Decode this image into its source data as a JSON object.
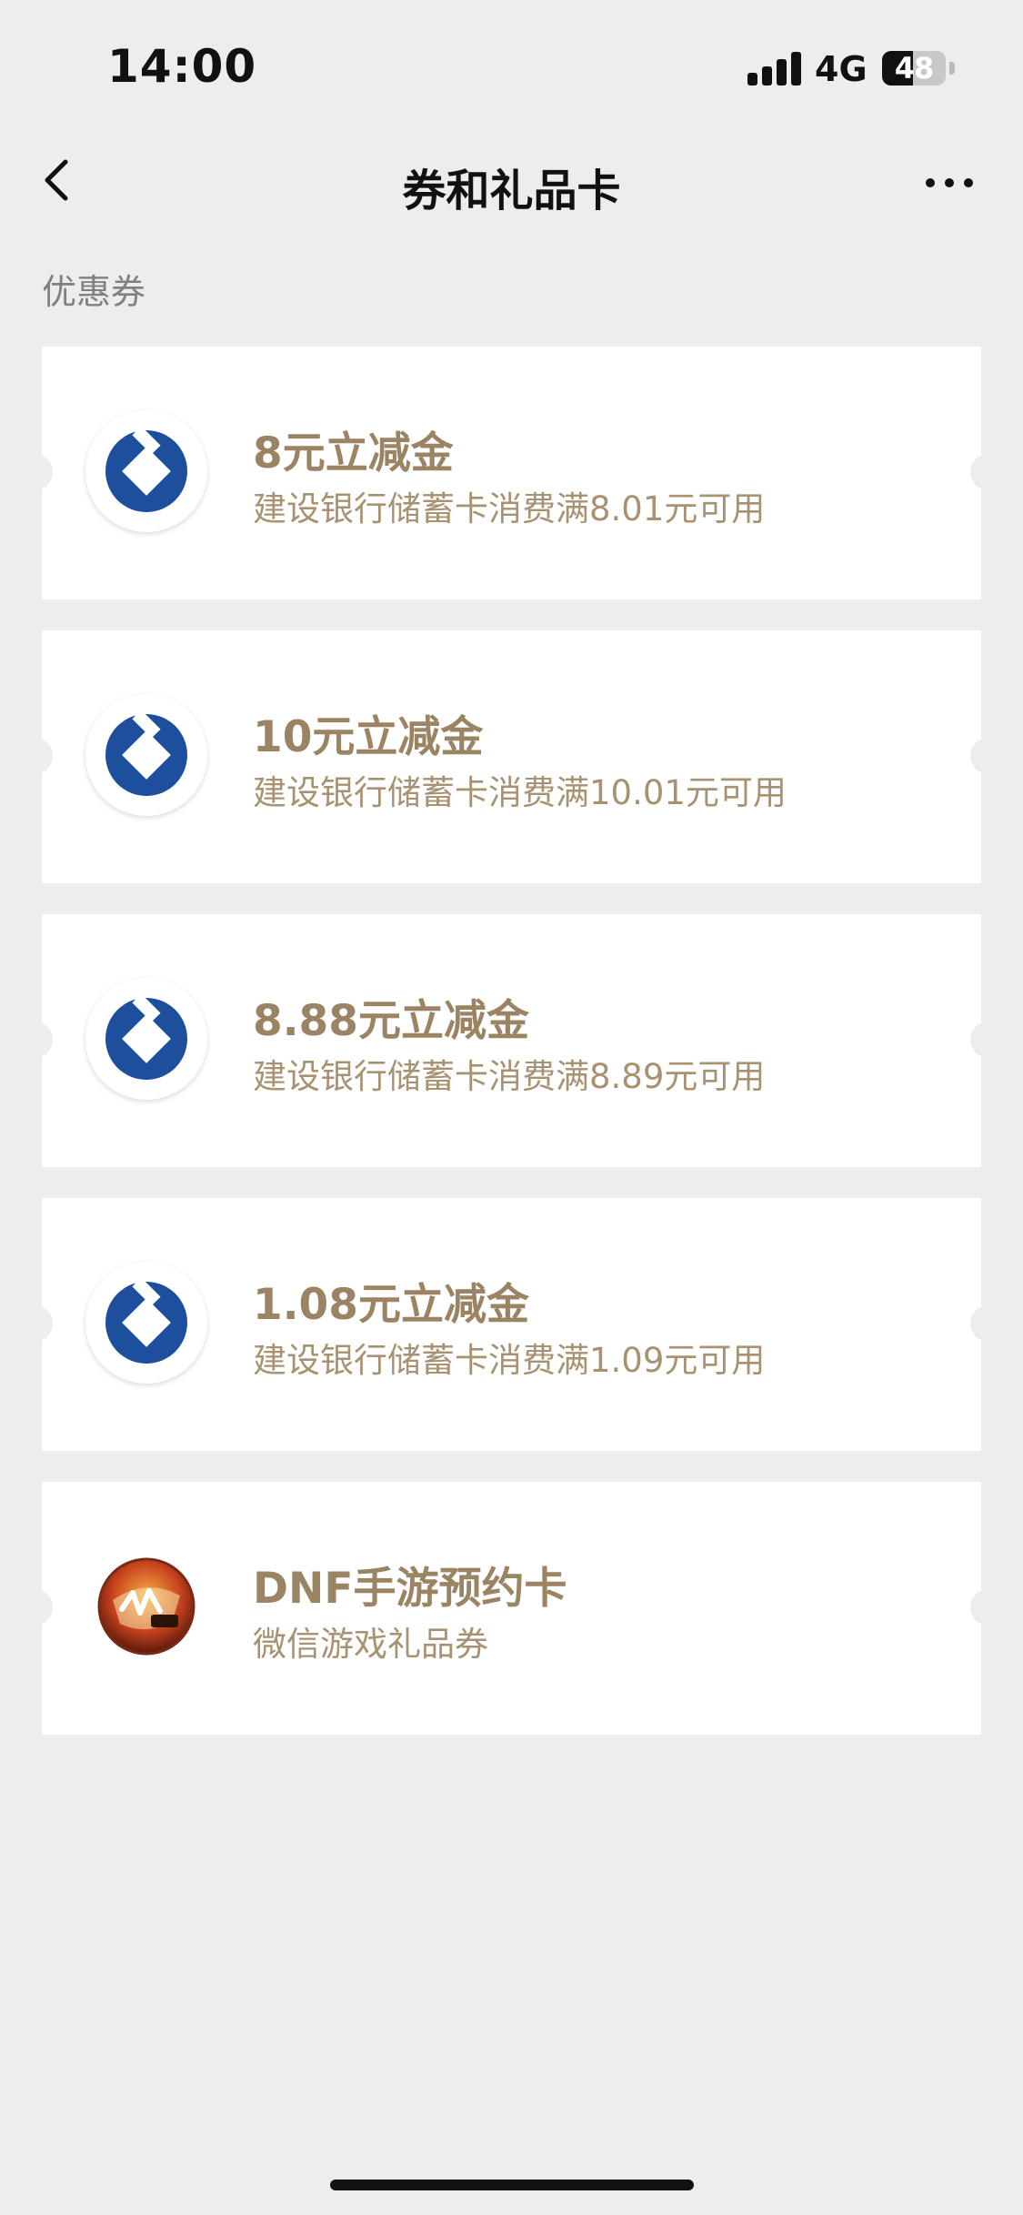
{
  "status_bar": {
    "time": "14:00",
    "network": "4G",
    "battery": "48",
    "battery_level": 0.48
  },
  "nav": {
    "title": "券和礼品卡",
    "back_icon": "chevron-left-icon",
    "more_icon": "more-horizontal-icon"
  },
  "section": {
    "title": "优惠券"
  },
  "coupons": [
    {
      "title": "8元立减金",
      "desc": "建设银行储蓄卡消费满8.01元可用",
      "logo": "ccb-bank-logo",
      "brand_color": "#1d4f9c"
    },
    {
      "title": "10元立减金",
      "desc": "建设银行储蓄卡消费满10.01元可用",
      "logo": "ccb-bank-logo",
      "brand_color": "#1d4f9c"
    },
    {
      "title": "8.88元立减金",
      "desc": "建设银行储蓄卡消费满8.89元可用",
      "logo": "ccb-bank-logo",
      "brand_color": "#1d4f9c"
    },
    {
      "title": "1.08元立减金",
      "desc": "建设银行储蓄卡消费满1.09元可用",
      "logo": "ccb-bank-logo",
      "brand_color": "#1d4f9c"
    },
    {
      "title": "DNF手游预约卡",
      "desc": "微信游戏礼品券",
      "logo": "dnf-game-logo",
      "brand_color": "#c8431d"
    }
  ],
  "colors": {
    "background": "#ededed",
    "card": "#ffffff",
    "title_gold": "#9a8463",
    "desc_gold": "#a89272"
  }
}
